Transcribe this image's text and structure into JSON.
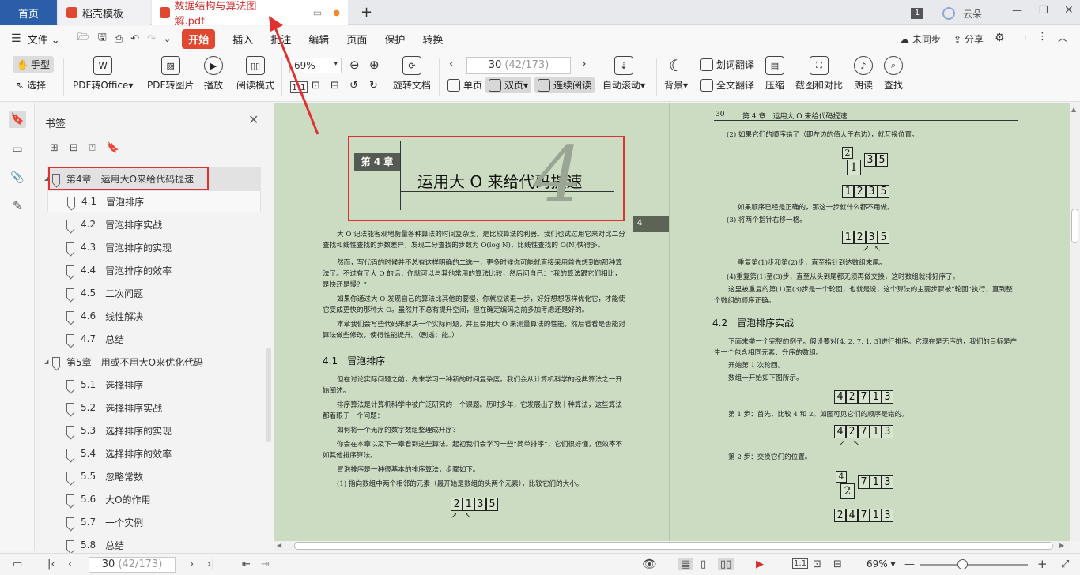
{
  "tabs": {
    "home": "首页",
    "template": "稻壳模板",
    "doc": "数据结构与算法图解.pdf",
    "new_tab": "+",
    "page_badge": "1",
    "cloud_user": "云朵"
  },
  "menu": {
    "file": "文件",
    "start": "开始",
    "insert": "插入",
    "annotate": "批注",
    "edit": "编辑",
    "page": "页面",
    "protect": "保护",
    "convert": "转换",
    "sync": "未同步",
    "share": "分享"
  },
  "ribbon": {
    "hand": "手型",
    "select": "选择",
    "pdf_to_office": "PDF转Office",
    "pdf_to_image": "PDF转图片",
    "play": "播放",
    "read_mode": "阅读模式",
    "zoom": "69%",
    "rotate": "旋转文档",
    "page_current": "30",
    "page_total": "(42/173)",
    "single": "单页",
    "double": "双页",
    "continuous": "连续阅读",
    "auto_scroll": "自动滚动",
    "background": "背景",
    "word_translate": "划词翻译",
    "full_translate": "全文翻译",
    "compress": "压缩",
    "screenshot_compare": "截图和对比",
    "read_aloud": "朗读",
    "find": "查找"
  },
  "sidebar": {
    "title": "书签",
    "items": [
      {
        "num": "",
        "label": "第4章　运用大O来给代码提速",
        "level": 0,
        "expanded": true
      },
      {
        "num": "4.1",
        "label": "冒泡排序",
        "level": 1
      },
      {
        "num": "4.2",
        "label": "冒泡排序实战",
        "level": 1
      },
      {
        "num": "4.3",
        "label": "冒泡排序的实现",
        "level": 1
      },
      {
        "num": "4.4",
        "label": "冒泡排序的效率",
        "level": 1
      },
      {
        "num": "4.5",
        "label": "二次问题",
        "level": 1
      },
      {
        "num": "4.6",
        "label": "线性解决",
        "level": 1
      },
      {
        "num": "4.7",
        "label": "总结",
        "level": 1
      },
      {
        "num": "",
        "label": "第5章　用或不用大O来优化代码",
        "level": 0,
        "expanded": true
      },
      {
        "num": "5.1",
        "label": "选择排序",
        "level": 1
      },
      {
        "num": "5.2",
        "label": "选择排序实战",
        "level": 1
      },
      {
        "num": "5.3",
        "label": "选择排序的实现",
        "level": 1
      },
      {
        "num": "5.4",
        "label": "选择排序的效率",
        "level": 1
      },
      {
        "num": "5.5",
        "label": "忽略常数",
        "level": 1
      },
      {
        "num": "5.6",
        "label": "大O的作用",
        "level": 1
      },
      {
        "num": "5.7",
        "label": "一个实例",
        "level": 1
      },
      {
        "num": "5.8",
        "label": "总结",
        "level": 1
      }
    ]
  },
  "left_page": {
    "chapter_tag": "第 4 章",
    "chapter_title": "运用大 O 来给代码提速",
    "chapter_big_num": "4",
    "side_tab": "4",
    "paragraphs": [
      "大 O 记法能客观地衡量各种算法的时间复杂度，是比较算法的利器。我们也试过用它来对比二分查找和线性查找的步数差异，发现二分查找的步数为 O(log N)，比线性查找的 O(N)快得多。",
      "然而，写代码的时候并不总有这样明确的二选一，更多时候你可能就直接采用首先想到的那种算法了。不过有了大 O 的话，你就可以与其他常用的算法比较，然后问自己：“我的算法跟它们相比，是快还是慢？”",
      "如果你通过大 O 发现自己的算法比其他的要慢，你就应该退一步，好好想想怎样优化它，才能使它变成更快的那种大 O。虽然并不总有提升空间，但在确定编码之前多加考虑还是好的。",
      "本章我们会写些代码来解决一个实际问题，并且会用大 O 来测量算法的性能，然后看看是否能对算法做些修改，使得性能提升。（剧透：能。）"
    ],
    "section_41": "4.1　冒泡排序",
    "p41": [
      "但在讨论实际问题之前，先来学习一种新的时间复杂度。我们会从计算机科学的经典算法之一开始阐述。",
      "排序算法是计算机科学中被广泛研究的一个课题。历时多年，它发展出了数十种算法，这些算法都着眼于一个问题：",
      "如何将一个无序的数字数组整理成升序？",
      "你会在本章以及下一章看到这些算法。起初我们会学习一些“简单排序”，它们很好懂，但效率不如其他排序算法。",
      "冒泡排序是一种很基本的排序算法，步骤如下。",
      "(1) 指向数组中两个相邻的元素（最开始是数组的头两个元素），比较它们的大小。"
    ],
    "array_a": [
      "2",
      "1",
      "3",
      "5"
    ]
  },
  "right_page": {
    "header_num": "30",
    "header_title": "第 4 章　运用大 O 来给代码提速",
    "step2": "(2) 如果它们的顺序错了（即左边的值大于右边），就互换位置。",
    "swap_top": "2",
    "swap_bottom": "1",
    "swap_rest": [
      "3",
      "5"
    ],
    "array_sorted": [
      "1",
      "2",
      "3",
      "5"
    ],
    "note_correct": "如果顺序已经是正确的，那这一步就什么都不用做。",
    "step3": "(3) 将两个指针右移一格。",
    "array_sorted2": [
      "1",
      "2",
      "3",
      "5"
    ],
    "repeat1": "重复第(1)步和第(2)步，直至指针到达数组末尾。",
    "repeat2": "(4)重复第(1)至(3)步，直至从头到尾都无须再做交换，这时数组就排好序了。",
    "repeat3": "这里被重复的第(1)至(3)步是一个轮回，也就是说，这个算法的主要步骤被“轮回”执行，直到整个数组的顺序正确。",
    "section_42": "4.2　冒泡排序实战",
    "p42": [
      "下面来举一个完整的例子。假设要对[4, 2, 7, 1, 3]进行排序。它现在是无序的，我们的目标是产生一个包含相同元素、升序的数组。",
      "开始第 1 次轮回。",
      "数组一开始如下图所示。"
    ],
    "array_start": [
      "4",
      "2",
      "7",
      "1",
      "3"
    ],
    "step_1": "第 1 步：首先，比较 4 和 2。如图可见它们的顺序是错的。",
    "array_step1": [
      "4",
      "2",
      "7",
      "1",
      "3"
    ],
    "step_2": "第 2 步：交换它们的位置。",
    "swap2_top": "4",
    "swap2_bottom": "2",
    "swap2_rest": [
      "7",
      "1",
      "3"
    ],
    "array_final": [
      "2",
      "4",
      "7",
      "1",
      "3"
    ]
  },
  "statusbar": {
    "page_current": "30",
    "page_total": "(42/173)",
    "zoom": "69%"
  },
  "colors": {
    "home_tab": "#2b5ea8",
    "start_accent": "#e0492f",
    "page_bg": "#cbdcc2",
    "highlight_red": "#e03131"
  }
}
